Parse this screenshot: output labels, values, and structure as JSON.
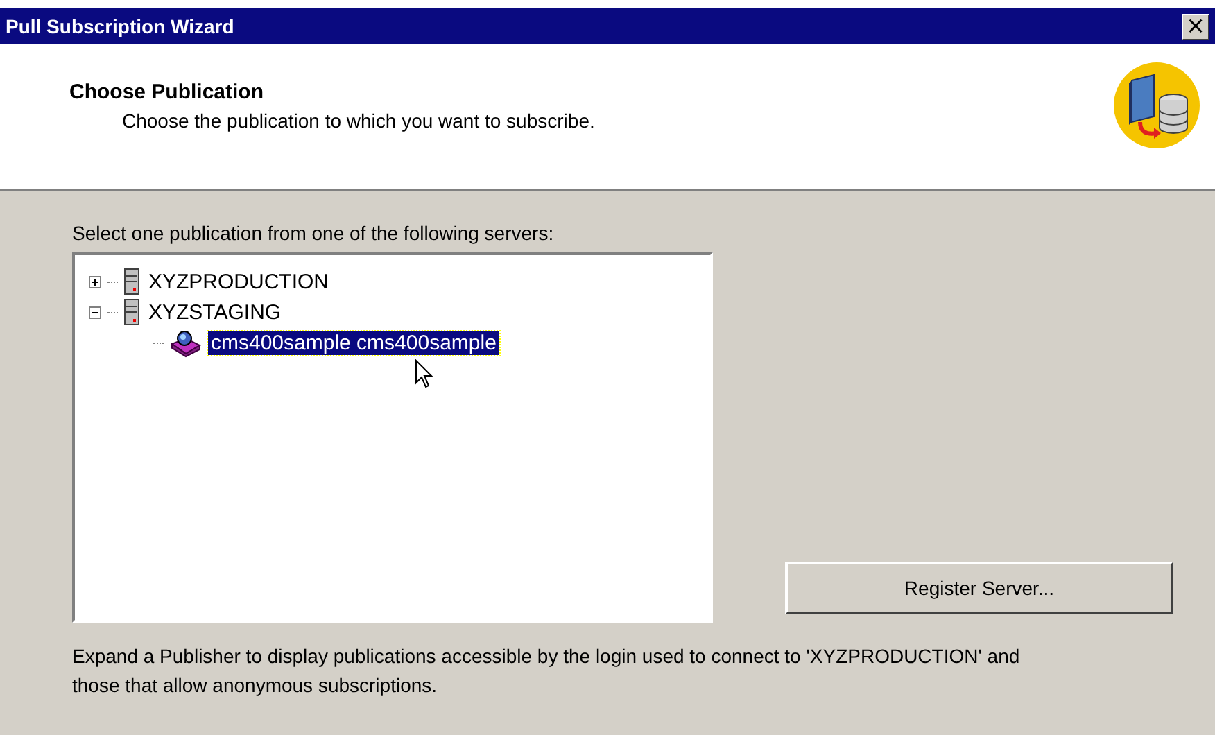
{
  "window": {
    "title": "Pull Subscription Wizard",
    "close": "×"
  },
  "header": {
    "title": "Choose Publication",
    "subtitle": "Choose the publication to which you want to subscribe."
  },
  "tree": {
    "label": "Select one publication from one of the following servers:",
    "items": [
      {
        "kind": "server",
        "label": "XYZPRODUCTION",
        "expanded": false,
        "selected": false
      },
      {
        "kind": "server",
        "label": "XYZSTAGING",
        "expanded": true,
        "selected": false,
        "children": [
          {
            "kind": "publication",
            "label": "cms400sample  cms400sample",
            "selected": true
          }
        ]
      }
    ]
  },
  "buttons": [
    {
      "label": "Register Server..."
    }
  ],
  "footer": "Expand a Publisher to display publications accessible by the login used to connect to 'XYZPRODUCTION' and those that allow anonymous subscriptions."
}
